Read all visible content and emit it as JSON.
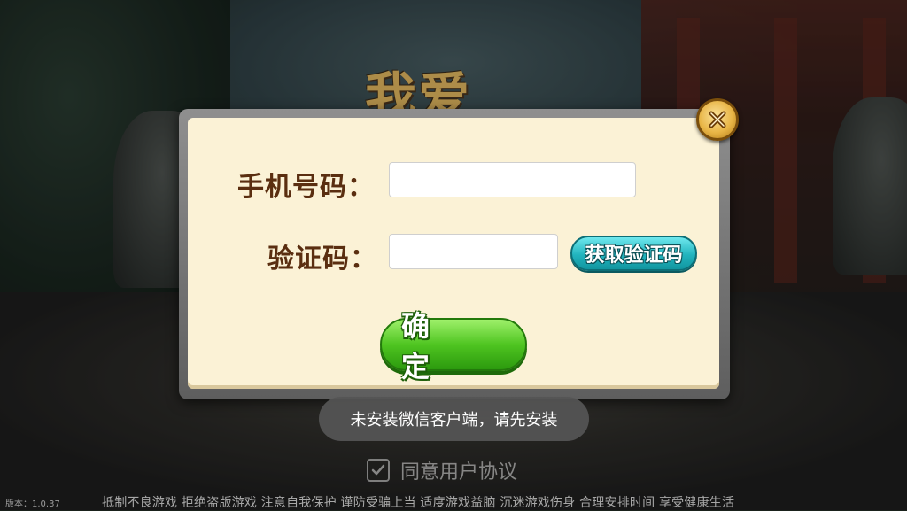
{
  "logo": {
    "text": "我爱"
  },
  "login_dialog": {
    "phone_label": "手机号码：",
    "phone_value": "",
    "code_label": "验证码：",
    "code_value": "",
    "get_code_button": "获取验证码",
    "confirm_button": "确 定",
    "close_icon": "close-x-icon"
  },
  "toast": {
    "message": "未安装微信客户端，请先安装"
  },
  "agreement": {
    "checked": true,
    "text": "同意用户协议"
  },
  "footer": {
    "version": "版本：1.0.37",
    "health_notice": "抵制不良游戏 拒绝盗版游戏 注意自我保护 谨防受骗上当 适度游戏益脑 沉迷游戏伤身 合理安排时间 享受健康生活"
  },
  "colors": {
    "dialog_bg": "#fbf2d6",
    "label_brown": "#5a2e10",
    "confirm_green": "#4fc521",
    "code_teal": "#22b4be",
    "close_gold": "#e8b546"
  }
}
